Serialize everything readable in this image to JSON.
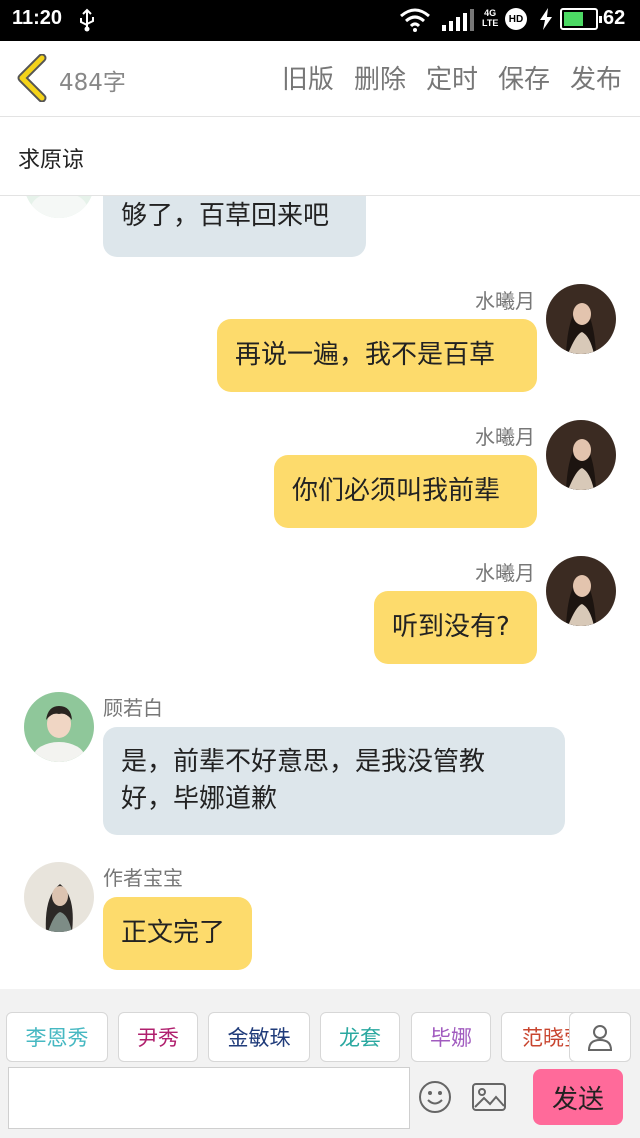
{
  "status_bar": {
    "time": "11:20",
    "network": "4G",
    "network_sub": "LTE",
    "hd": "HD",
    "battery_percent": "62",
    "battery_level": 0.62
  },
  "toolbar": {
    "word_count": "484字",
    "actions": {
      "old": "旧版",
      "delete": "删除",
      "schedule": "定时",
      "save": "保存",
      "publish": "发布"
    }
  },
  "story": {
    "title": "求原谅"
  },
  "messages": [
    {
      "side": "left",
      "name": "",
      "text": "够了，百草回来吧"
    },
    {
      "side": "right",
      "name": "水曦月",
      "text": "再说一遍，我不是百草"
    },
    {
      "side": "right",
      "name": "水曦月",
      "text": "你们必须叫我前辈"
    },
    {
      "side": "right",
      "name": "水曦月",
      "text": "听到没有?"
    },
    {
      "side": "left",
      "name": "顾若白",
      "text": "是，前辈不好意思，是我没管教\n好，毕娜道歉"
    },
    {
      "side": "left",
      "name": "作者宝宝",
      "text": "正文完了"
    }
  ],
  "characters": [
    {
      "name": "李恩秀",
      "color": "#46b8c2"
    },
    {
      "name": "尹秀",
      "color": "#b0206e"
    },
    {
      "name": "金敏珠",
      "color": "#1f3b7a"
    },
    {
      "name": "龙套",
      "color": "#2aa8a0"
    },
    {
      "name": "毕娜",
      "color": "#a15bbf"
    },
    {
      "name": "范晓莹",
      "color": "#c8452f"
    }
  ],
  "composer": {
    "input_value": "",
    "send_label": "发送"
  },
  "colors": {
    "bubble_right": "#fddb6c",
    "bubble_left": "#dde6eb",
    "send_button": "#ff6a9a",
    "back_arrow": "#f4d31a"
  }
}
